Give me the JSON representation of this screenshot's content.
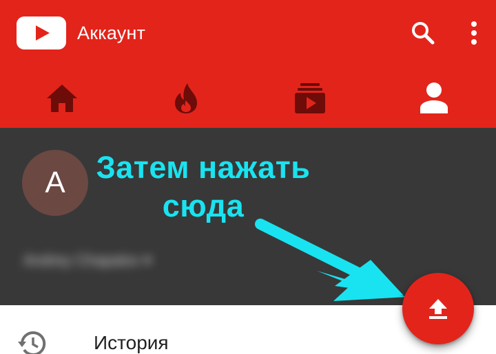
{
  "app_bar": {
    "title": "Аккаунт",
    "logo_icon": "youtube-logo-icon",
    "actions": [
      {
        "icon": "search-icon"
      },
      {
        "icon": "more-vert-icon"
      }
    ],
    "background_color": "#e3241b"
  },
  "tabs": [
    {
      "icon": "home-icon",
      "selected": false
    },
    {
      "icon": "trending-icon",
      "selected": false
    },
    {
      "icon": "subscriptions-icon",
      "selected": false
    },
    {
      "icon": "account-icon",
      "selected": true
    }
  ],
  "account": {
    "avatar_letter": "A",
    "avatar_color": "#6b4842",
    "name": "Andrey Chapalov ▾",
    "name_blurred": true,
    "header_color": "#383838"
  },
  "annotation": {
    "text_line1": "Затем нажать",
    "text_line2": "сюда",
    "color": "#19e3f0"
  },
  "fab": {
    "icon": "upload-icon",
    "color": "#e3241b"
  },
  "list": {
    "items": [
      {
        "icon": "history-icon",
        "label": "История"
      }
    ]
  }
}
